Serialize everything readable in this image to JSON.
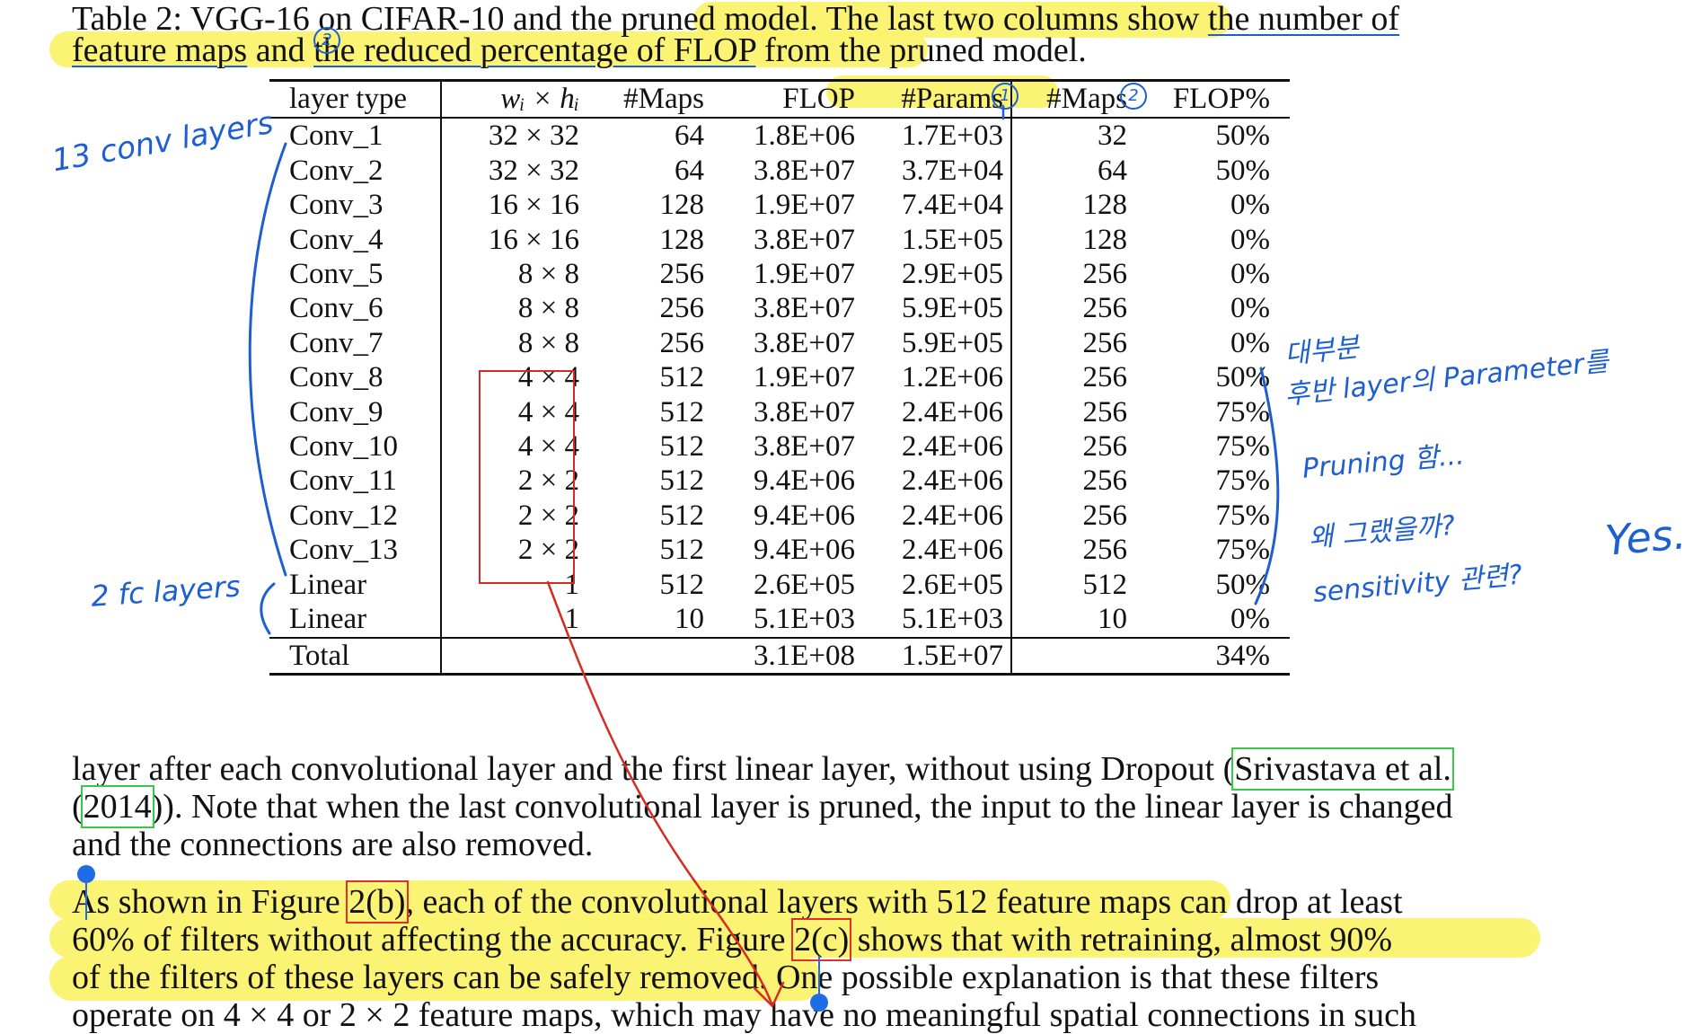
{
  "caption": {
    "line1_plain": "Table 2: VGG-16 on CIFAR-10 and the pruned model",
    "line1_hl_a": ". The last two columns show ",
    "line1_ul": "the number of",
    "line2_ul_a": "feature maps",
    "line2_and": " and ",
    "line2_ul_b": "the reduced percentage of FLOP",
    "line2_rest": " from the pruned model."
  },
  "table": {
    "headers": [
      "layer type",
      "wᵢ × hᵢ",
      "#Maps",
      "FLOP",
      "#Params",
      "#Maps",
      "FLOP%"
    ],
    "rows": [
      [
        "Conv_1",
        "32 × 32",
        "64",
        "1.8E+06",
        "1.7E+03",
        "32",
        "50%"
      ],
      [
        "Conv_2",
        "32 × 32",
        "64",
        "3.8E+07",
        "3.7E+04",
        "64",
        "50%"
      ],
      [
        "Conv_3",
        "16 × 16",
        "128",
        "1.9E+07",
        "7.4E+04",
        "128",
        "0%"
      ],
      [
        "Conv_4",
        "16 × 16",
        "128",
        "3.8E+07",
        "1.5E+05",
        "128",
        "0%"
      ],
      [
        "Conv_5",
        "8 × 8",
        "256",
        "1.9E+07",
        "2.9E+05",
        "256",
        "0%"
      ],
      [
        "Conv_6",
        "8 × 8",
        "256",
        "3.8E+07",
        "5.9E+05",
        "256",
        "0%"
      ],
      [
        "Conv_7",
        "8 × 8",
        "256",
        "3.8E+07",
        "5.9E+05",
        "256",
        "0%"
      ],
      [
        "Conv_8",
        "4 × 4",
        "512",
        "1.9E+07",
        "1.2E+06",
        "256",
        "50%"
      ],
      [
        "Conv_9",
        "4 × 4",
        "512",
        "3.8E+07",
        "2.4E+06",
        "256",
        "75%"
      ],
      [
        "Conv_10",
        "4 × 4",
        "512",
        "3.8E+07",
        "2.4E+06",
        "256",
        "75%"
      ],
      [
        "Conv_11",
        "2 × 2",
        "512",
        "9.4E+06",
        "2.4E+06",
        "256",
        "75%"
      ],
      [
        "Conv_12",
        "2 × 2",
        "512",
        "9.4E+06",
        "2.4E+06",
        "256",
        "75%"
      ],
      [
        "Conv_13",
        "2 × 2",
        "512",
        "9.4E+06",
        "2.4E+06",
        "256",
        "75%"
      ],
      [
        "Linear",
        "1",
        "512",
        "2.6E+05",
        "2.6E+05",
        "512",
        "50%"
      ],
      [
        "Linear",
        "1",
        "10",
        "5.1E+03",
        "5.1E+03",
        "10",
        "0%"
      ]
    ],
    "total": [
      "Total",
      "",
      "",
      "3.1E+08",
      "1.5E+07",
      "",
      "34%"
    ]
  },
  "paragraph1": {
    "l1_a": "layer after each convolutional layer and the first linear layer, without using Dropout (",
    "l1_cite": "Srivastava et al.",
    "l2_open": "(",
    "l2_cite": "2014",
    "l2_rest": ")). Note that when the last convolutional layer is pruned, the input to the linear layer is changed",
    "l3": "and the connections are also removed."
  },
  "paragraph2": {
    "l1_a": "As shown in Figure ",
    "l1_ref": "2(b)",
    "l1_b": ", each of the convolutional layers with 512 feature maps can drop at least",
    "l2_a": "60% of filters without affecting the accuracy. Figure ",
    "l2_ref": "2(c)",
    "l2_b": " shows that with retraining, almost 90%",
    "l3_a": "of the filters of these layers can be safely removed.",
    "l3_b": " One possible explanation is that these filters",
    "l4": "operate on 4 × 4 or 2 × 2 feature maps, which may have no meaningful spatial connections in such"
  },
  "annotations": {
    "conv_note": "13 conv layers",
    "fc_note": "2 fc layers",
    "circle_1": "1",
    "circle_2": "2",
    "korean_1": "대부분",
    "korean_2": "후반 layer의 Parameter를",
    "korean_3": "Pruning 함...",
    "korean_4": "왜 그랬을까?",
    "korean_5": "sensitivity 관련?",
    "yes": "Yes."
  },
  "colors": {
    "highlight": "#fbf26b",
    "ink_blue": "#1d5fd0",
    "ink_red": "#d62b22",
    "cite_green": "#39c84a"
  }
}
